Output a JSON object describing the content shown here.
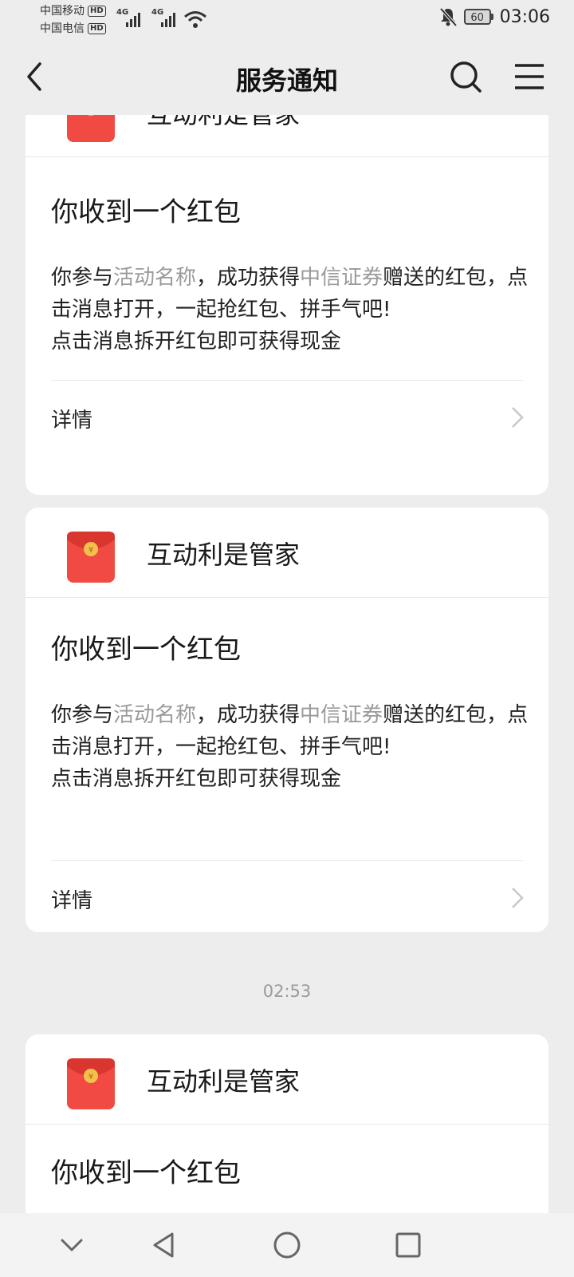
{
  "status_bar": {
    "carrier1": "中国移动",
    "carrier2": "中国电信",
    "hd": "HD",
    "net1": "4G",
    "net2": "4G",
    "battery": "60",
    "time": "03:06"
  },
  "header": {
    "title": "服务通知",
    "back_icon": "back-arrow-icon",
    "search_icon": "search-icon",
    "menu_icon": "menu-icon"
  },
  "cards": [
    {
      "sender": "互动利是管家",
      "title": "你收到一个红包",
      "body_pre": "你参与",
      "activity": "活动名称",
      "body_mid": "，成功获得",
      "company": "中信证券",
      "body_post": "赠送的红包，点击消息打开，一起抢红包、拼手气吧!",
      "body_line3": "点击消息拆开红包即可获得现金",
      "detail_label": "详情"
    },
    {
      "sender": "互动利是管家",
      "title": "你收到一个红包",
      "body_pre": "你参与",
      "activity": "活动名称",
      "body_mid": "，成功获得",
      "company": "中信证券",
      "body_post": "赠送的红包，点击消息打开，一起抢红包、拼手气吧!",
      "body_line3": "点击消息拆开红包即可获得现金",
      "detail_label": "详情"
    },
    {
      "sender": "互动利是管家",
      "title": "你收到一个红包"
    }
  ],
  "timestamp": "02:53",
  "colors": {
    "background": "#ededed",
    "card": "#ffffff",
    "highlight_text": "#9a9a9a",
    "red_packet": "#f04a43",
    "coin": "#f2c14b"
  },
  "system_nav": [
    "collapse-icon",
    "back-triangle-icon",
    "home-circle-icon",
    "recents-square-icon"
  ]
}
